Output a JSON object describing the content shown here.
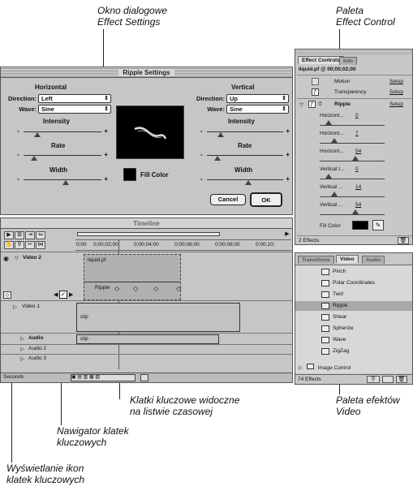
{
  "captions": {
    "effect_settings": [
      "Okno dialogowe",
      "Effect Settings"
    ],
    "effect_control": [
      "Paleta",
      "Effect Control"
    ],
    "keyframes_on_timeline": [
      "Klatki kluczowe widoczne",
      "na listwie czasowej"
    ],
    "video_effects": [
      "Paleta efektów",
      "Video"
    ],
    "keyframe_navigator": [
      "Nawigator klatek",
      "kluczowych"
    ],
    "keyframe_icons": [
      "Wyświetlanie ikon",
      "klatek kluczowych"
    ]
  },
  "ripple_dialog": {
    "title": "Ripple Settings",
    "horizontal": {
      "heading": "Horizontal",
      "direction_label": "Direction:",
      "direction_value": "Left",
      "wave_label": "Wave:",
      "wave_value": "Sine",
      "intensity_label": "Intensity",
      "rate_label": "Rate",
      "width_label": "Width",
      "intensity_level": 0.15,
      "rate_level": 0.1,
      "width_level": 0.55
    },
    "vertical": {
      "heading": "Vertical",
      "direction_label": "Direction:",
      "direction_value": "Up",
      "wave_label": "Wave:",
      "wave_value": "Sine",
      "intensity_label": "Intensity",
      "rate_label": "Rate",
      "width_label": "Width",
      "intensity_level": 0.15,
      "rate_level": 0.1,
      "width_level": 0.55
    },
    "fill_color_label": "Fill Color",
    "cancel_label": "Cancel",
    "ok_label": "OK",
    "minus": "-",
    "plus": "+"
  },
  "timeline": {
    "title": "Timeline",
    "ruler": [
      "0;00",
      "0;00;02;00",
      "0;00;04;00",
      "0;00;06;00",
      "0;00;08;00",
      "0;00;10;"
    ],
    "tracks": {
      "video2": "Video 2",
      "video1": "Video 1",
      "audio1": "Audio",
      "audio2": "Audio 2",
      "audio3": "Audio 3"
    },
    "clips": {
      "v2_clip": "liquid.pf",
      "v2_effect": "Ripple",
      "v1_clip": "clip",
      "a1_clip": "clip"
    },
    "time_unit": "Seconds"
  },
  "effect_controls": {
    "tabs": [
      "Effect Controls",
      "Info"
    ],
    "header": "liquid.pf @ 00;00;02;00",
    "motion_label": "Motion",
    "transparency_label": "Transparency",
    "setup_label": "Setup",
    "ripple_label": "Ripple",
    "params": [
      {
        "label": "Horizont...",
        "value": "0",
        "level": 0.1
      },
      {
        "label": "Horizont...",
        "value": "7",
        "level": 0.2
      },
      {
        "label": "Horizont...",
        "value": "54",
        "level": 0.55
      },
      {
        "label": "Vertical I...",
        "value": "0",
        "level": 0.1
      },
      {
        "label": "Vertical ...",
        "value": "14",
        "level": 0.2
      },
      {
        "label": "Vertical ...",
        "value": "54",
        "level": 0.55
      }
    ],
    "fill_color_label": "Fill Color",
    "count_label": "2 Effects"
  },
  "video_palette": {
    "tabs": [
      "Transitions",
      "Video",
      "Audio"
    ],
    "items": [
      "Pinch",
      "Polar Coordinates",
      "Twirl",
      "Ripple",
      "Shear",
      "Spherize",
      "Wave",
      "ZigZag"
    ],
    "selected": "Ripple",
    "folder_label": "Image Control",
    "count_label": "74 Effects"
  }
}
